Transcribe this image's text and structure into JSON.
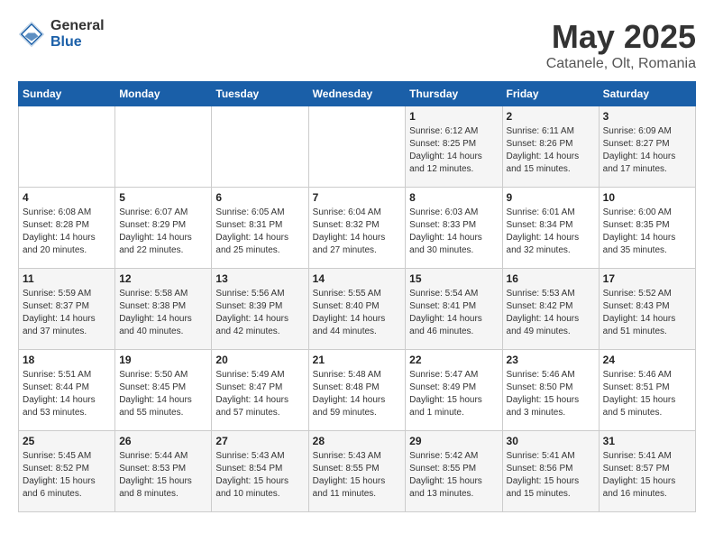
{
  "logo": {
    "general": "General",
    "blue": "Blue"
  },
  "title": "May 2025",
  "location": "Catanele, Olt, Romania",
  "days_of_week": [
    "Sunday",
    "Monday",
    "Tuesday",
    "Wednesday",
    "Thursday",
    "Friday",
    "Saturday"
  ],
  "weeks": [
    [
      {
        "day": "",
        "info": ""
      },
      {
        "day": "",
        "info": ""
      },
      {
        "day": "",
        "info": ""
      },
      {
        "day": "",
        "info": ""
      },
      {
        "day": "1",
        "info": "Sunrise: 6:12 AM\nSunset: 8:25 PM\nDaylight: 14 hours\nand 12 minutes."
      },
      {
        "day": "2",
        "info": "Sunrise: 6:11 AM\nSunset: 8:26 PM\nDaylight: 14 hours\nand 15 minutes."
      },
      {
        "day": "3",
        "info": "Sunrise: 6:09 AM\nSunset: 8:27 PM\nDaylight: 14 hours\nand 17 minutes."
      }
    ],
    [
      {
        "day": "4",
        "info": "Sunrise: 6:08 AM\nSunset: 8:28 PM\nDaylight: 14 hours\nand 20 minutes."
      },
      {
        "day": "5",
        "info": "Sunrise: 6:07 AM\nSunset: 8:29 PM\nDaylight: 14 hours\nand 22 minutes."
      },
      {
        "day": "6",
        "info": "Sunrise: 6:05 AM\nSunset: 8:31 PM\nDaylight: 14 hours\nand 25 minutes."
      },
      {
        "day": "7",
        "info": "Sunrise: 6:04 AM\nSunset: 8:32 PM\nDaylight: 14 hours\nand 27 minutes."
      },
      {
        "day": "8",
        "info": "Sunrise: 6:03 AM\nSunset: 8:33 PM\nDaylight: 14 hours\nand 30 minutes."
      },
      {
        "day": "9",
        "info": "Sunrise: 6:01 AM\nSunset: 8:34 PM\nDaylight: 14 hours\nand 32 minutes."
      },
      {
        "day": "10",
        "info": "Sunrise: 6:00 AM\nSunset: 8:35 PM\nDaylight: 14 hours\nand 35 minutes."
      }
    ],
    [
      {
        "day": "11",
        "info": "Sunrise: 5:59 AM\nSunset: 8:37 PM\nDaylight: 14 hours\nand 37 minutes."
      },
      {
        "day": "12",
        "info": "Sunrise: 5:58 AM\nSunset: 8:38 PM\nDaylight: 14 hours\nand 40 minutes."
      },
      {
        "day": "13",
        "info": "Sunrise: 5:56 AM\nSunset: 8:39 PM\nDaylight: 14 hours\nand 42 minutes."
      },
      {
        "day": "14",
        "info": "Sunrise: 5:55 AM\nSunset: 8:40 PM\nDaylight: 14 hours\nand 44 minutes."
      },
      {
        "day": "15",
        "info": "Sunrise: 5:54 AM\nSunset: 8:41 PM\nDaylight: 14 hours\nand 46 minutes."
      },
      {
        "day": "16",
        "info": "Sunrise: 5:53 AM\nSunset: 8:42 PM\nDaylight: 14 hours\nand 49 minutes."
      },
      {
        "day": "17",
        "info": "Sunrise: 5:52 AM\nSunset: 8:43 PM\nDaylight: 14 hours\nand 51 minutes."
      }
    ],
    [
      {
        "day": "18",
        "info": "Sunrise: 5:51 AM\nSunset: 8:44 PM\nDaylight: 14 hours\nand 53 minutes."
      },
      {
        "day": "19",
        "info": "Sunrise: 5:50 AM\nSunset: 8:45 PM\nDaylight: 14 hours\nand 55 minutes."
      },
      {
        "day": "20",
        "info": "Sunrise: 5:49 AM\nSunset: 8:47 PM\nDaylight: 14 hours\nand 57 minutes."
      },
      {
        "day": "21",
        "info": "Sunrise: 5:48 AM\nSunset: 8:48 PM\nDaylight: 14 hours\nand 59 minutes."
      },
      {
        "day": "22",
        "info": "Sunrise: 5:47 AM\nSunset: 8:49 PM\nDaylight: 15 hours\nand 1 minute."
      },
      {
        "day": "23",
        "info": "Sunrise: 5:46 AM\nSunset: 8:50 PM\nDaylight: 15 hours\nand 3 minutes."
      },
      {
        "day": "24",
        "info": "Sunrise: 5:46 AM\nSunset: 8:51 PM\nDaylight: 15 hours\nand 5 minutes."
      }
    ],
    [
      {
        "day": "25",
        "info": "Sunrise: 5:45 AM\nSunset: 8:52 PM\nDaylight: 15 hours\nand 6 minutes."
      },
      {
        "day": "26",
        "info": "Sunrise: 5:44 AM\nSunset: 8:53 PM\nDaylight: 15 hours\nand 8 minutes."
      },
      {
        "day": "27",
        "info": "Sunrise: 5:43 AM\nSunset: 8:54 PM\nDaylight: 15 hours\nand 10 minutes."
      },
      {
        "day": "28",
        "info": "Sunrise: 5:43 AM\nSunset: 8:55 PM\nDaylight: 15 hours\nand 11 minutes."
      },
      {
        "day": "29",
        "info": "Sunrise: 5:42 AM\nSunset: 8:55 PM\nDaylight: 15 hours\nand 13 minutes."
      },
      {
        "day": "30",
        "info": "Sunrise: 5:41 AM\nSunset: 8:56 PM\nDaylight: 15 hours\nand 15 minutes."
      },
      {
        "day": "31",
        "info": "Sunrise: 5:41 AM\nSunset: 8:57 PM\nDaylight: 15 hours\nand 16 minutes."
      }
    ]
  ]
}
